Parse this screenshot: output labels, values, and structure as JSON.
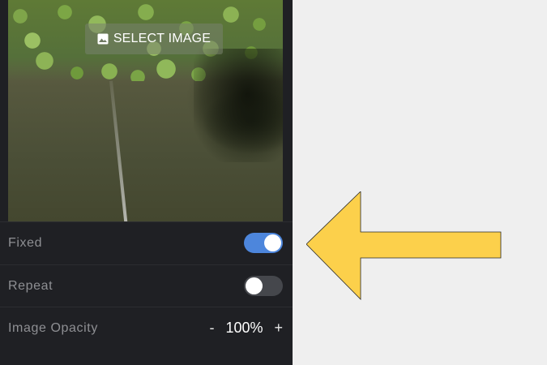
{
  "image_panel": {
    "select_label": "SELECT IMAGE",
    "icon": "image-icon"
  },
  "settings": {
    "fixed": {
      "label": "Fixed",
      "enabled": true
    },
    "repeat": {
      "label": "Repeat",
      "enabled": false
    },
    "opacity": {
      "label": "Image Opacity",
      "decrement": "-",
      "value": "100%",
      "increment": "+"
    }
  },
  "colors": {
    "panel_bg": "#1f2024",
    "toggle_on": "#4d86dc",
    "toggle_off": "#45474c",
    "arrow_fill": "#fcd04b"
  },
  "annotation": {
    "icon": "left-arrow-icon"
  }
}
